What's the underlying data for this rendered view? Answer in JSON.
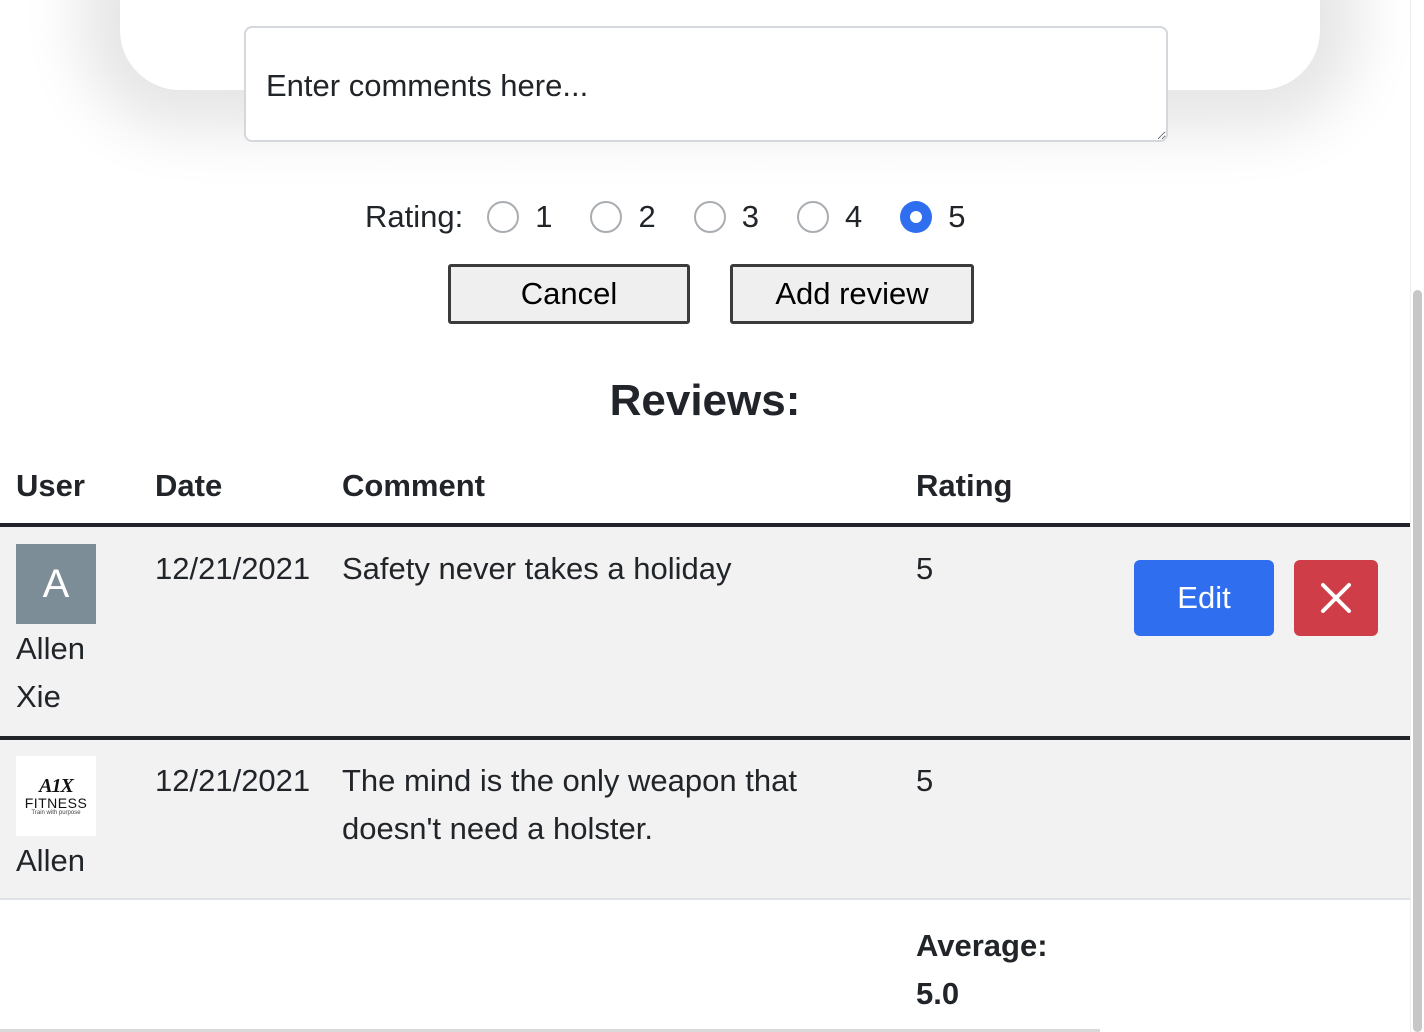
{
  "form": {
    "comment_placeholder": "Enter comments here...",
    "rating_label": "Rating:",
    "rating_options": [
      "1",
      "2",
      "3",
      "4",
      "5"
    ],
    "rating_selected": "5",
    "cancel_label": "Cancel",
    "add_label": "Add review"
  },
  "reviews": {
    "heading": "Reviews:",
    "columns": {
      "user": "User",
      "date": "Date",
      "comment": "Comment",
      "rating": "Rating"
    },
    "rows": [
      {
        "avatar_letter": "A",
        "user_first": "Allen",
        "user_last": "Xie",
        "date": "12/21/2021",
        "comment": "Safety never takes a holiday",
        "rating": "5",
        "edit_label": "Edit"
      },
      {
        "avatar_logo_text_1": "A1X",
        "avatar_logo_text_2": "FITNESS",
        "avatar_logo_text_3": "Train with purpose",
        "user_first": "Allen",
        "date": "12/21/2021",
        "comment_line1": "The mind is the only weapon that",
        "comment_line2": "doesn't need a holster.",
        "rating": "5"
      }
    ],
    "average_label": "Average:",
    "average_value": "5.0"
  },
  "colors": {
    "primary": "#2f6fef",
    "danger": "#cf3e48",
    "avatar_bg": "#7d8d98",
    "row_bg": "#f2f2f2"
  }
}
